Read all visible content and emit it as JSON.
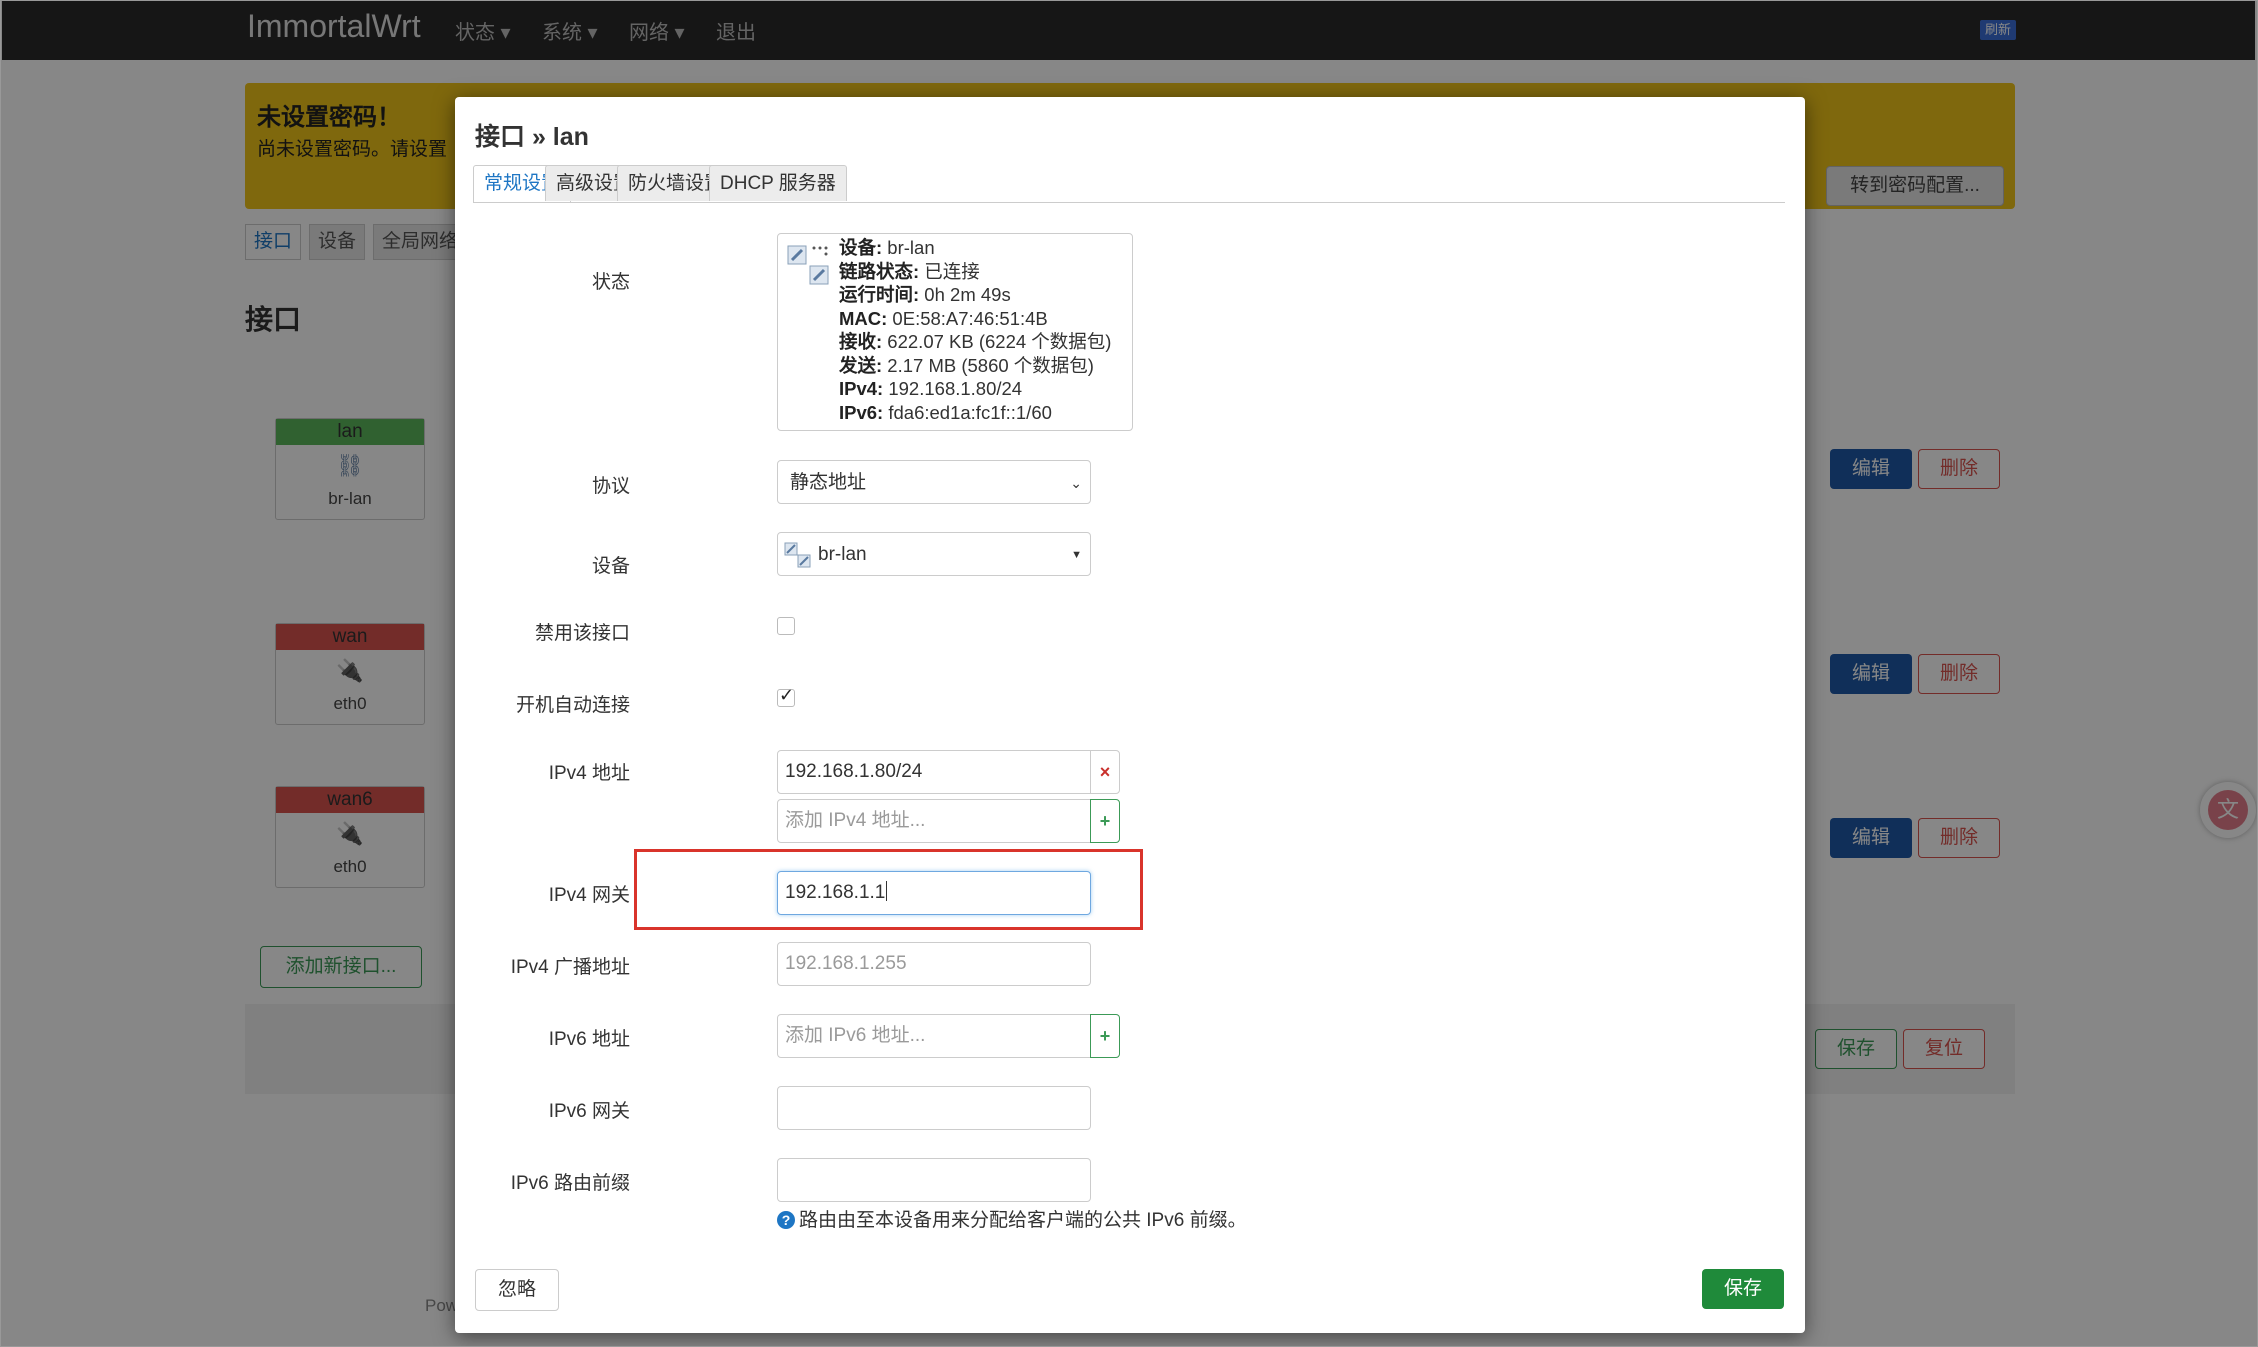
{
  "background": {
    "brand": "ImmortalWrt",
    "nav": [
      "状态",
      "系统",
      "网络",
      "退出"
    ],
    "refresh_badge": "刷新",
    "warning_title": "未设置密码！",
    "warning_text": "尚未设置密码。请设置",
    "warning_button": "转到密码配置...",
    "subtabs": [
      "接口",
      "设备",
      "全局网络"
    ],
    "page_heading": "接口",
    "interfaces": [
      {
        "name": "lan",
        "device": "br-lan",
        "color": "#5cb85c"
      },
      {
        "name": "wan",
        "device": "eth0",
        "color": "#d9534f"
      },
      {
        "name": "wan6",
        "device": "eth0",
        "color": "#d9534f"
      }
    ],
    "edit_label": "编辑",
    "delete_label": "删除",
    "add_interface": "添加新接口...",
    "save_label": "保存",
    "reset_label": "复位",
    "powered": "Pow"
  },
  "modal": {
    "title": "接口 » lan",
    "tabs": [
      "常规设置",
      "高级设置",
      "防火墙设置",
      "DHCP 服务器"
    ],
    "status_label": "状态",
    "status": {
      "device_key": "设备:",
      "device_val": " br-lan",
      "link_key": "链路状态:",
      "link_val": " 已连接",
      "uptime_key": "运行时间:",
      "uptime_val": " 0h 2m 49s",
      "mac_key": "MAC:",
      "mac_val": " 0E:58:A7:46:51:4B",
      "rx_key": "接收:",
      "rx_val": " 622.07 KB (6224 个数据包)",
      "tx_key": "发送:",
      "tx_val": " 2.17 MB (5860 个数据包)",
      "ipv4_key": "IPv4:",
      "ipv4_val": " 192.168.1.80/24",
      "ipv6_key": "IPv6:",
      "ipv6_val": " fda6:ed1a:fc1f::1/60"
    },
    "protocol_label": "协议",
    "protocol_value": "静态地址",
    "device_label": "设备",
    "device_value": "br-lan",
    "disable_label": "禁用该接口",
    "autostart_label": "开机自动连接",
    "ipv4_addr_label": "IPv4 地址",
    "ipv4_addr_value": "192.168.1.80/24",
    "ipv4_addr_placeholder": "添加 IPv4 地址...",
    "ipv4_gw_label": "IPv4 网关",
    "ipv4_gw_value": "192.168.1.1",
    "ipv4_bcast_label": "IPv4 广播地址",
    "ipv4_bcast_placeholder": "192.168.1.255",
    "ipv6_addr_label": "IPv6 地址",
    "ipv6_addr_placeholder": "添加 IPv6 地址...",
    "ipv6_gw_label": "IPv6 网关",
    "ipv6_prefix_label": "IPv6 路由前缀",
    "ipv6_prefix_hint": "路由由至本设备用来分配给客户端的公共 IPv6 前缀。",
    "ignore_label": "忽略",
    "save_label": "保存",
    "remove_symbol": "×",
    "add_symbol": "+"
  }
}
